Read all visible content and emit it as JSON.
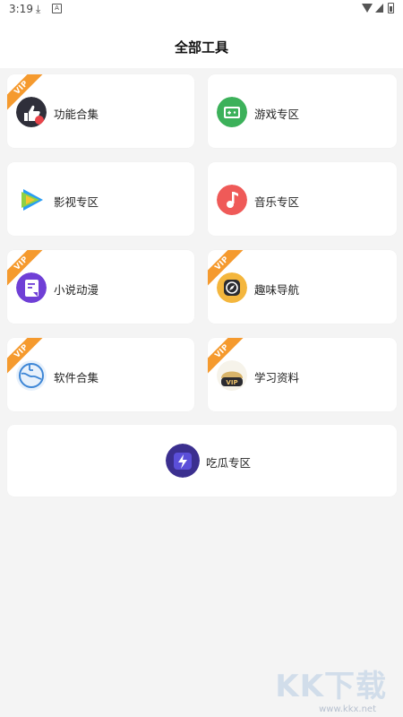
{
  "status_bar": {
    "time": "3:19",
    "download_icon": "download-icon",
    "notification_icon": "a-icon",
    "wifi_icon": "wifi-icon",
    "signal_icon": "signal-icon",
    "battery_icon": "battery-icon"
  },
  "header": {
    "title": "全部工具"
  },
  "vip_label": "VIP",
  "colors": {
    "accent_vip": "#f59a2e",
    "background": "#f4f4f4",
    "card": "#ffffff"
  },
  "tools": [
    {
      "label": "功能合集",
      "icon": "thumbs-up-icon",
      "vip": true
    },
    {
      "label": "游戏专区",
      "icon": "game-controller-icon",
      "vip": false
    },
    {
      "label": "影视专区",
      "icon": "video-play-icon",
      "vip": false
    },
    {
      "label": "音乐专区",
      "icon": "music-note-icon",
      "vip": false
    },
    {
      "label": "小说动漫",
      "icon": "novel-book-icon",
      "vip": true
    },
    {
      "label": "趣味导航",
      "icon": "compass-icon",
      "vip": true
    },
    {
      "label": "软件合集",
      "icon": "software-globe-icon",
      "vip": true
    },
    {
      "label": "学习资料",
      "icon": "study-vip-icon",
      "vip": true
    },
    {
      "label": "吃瓜专区",
      "icon": "lightning-icon",
      "vip": false
    }
  ],
  "watermark": {
    "text": "KK下载",
    "url": "www.kkx.net"
  }
}
